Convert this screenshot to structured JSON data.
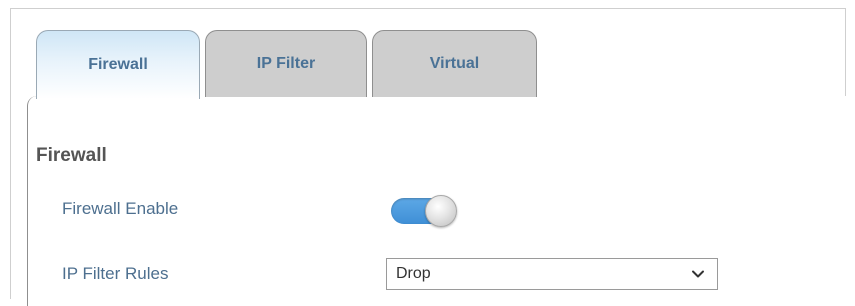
{
  "tabs": [
    {
      "label": "Firewall",
      "active": true
    },
    {
      "label": "IP Filter",
      "active": false
    },
    {
      "label": "Virtual",
      "active": false
    }
  ],
  "section": {
    "title": "Firewall"
  },
  "fields": {
    "firewall_enable": {
      "label": "Firewall Enable",
      "state": "on"
    },
    "ip_filter_rules": {
      "label": "IP Filter Rules",
      "value": "Drop"
    }
  },
  "colors": {
    "tab_text": "#4a7296",
    "label_text": "#4d6f8f",
    "toggle_on": "#3f8fd6",
    "inactive_tab_bg": "#cecece"
  },
  "icons": {
    "dropdown": "chevron-down-icon"
  }
}
